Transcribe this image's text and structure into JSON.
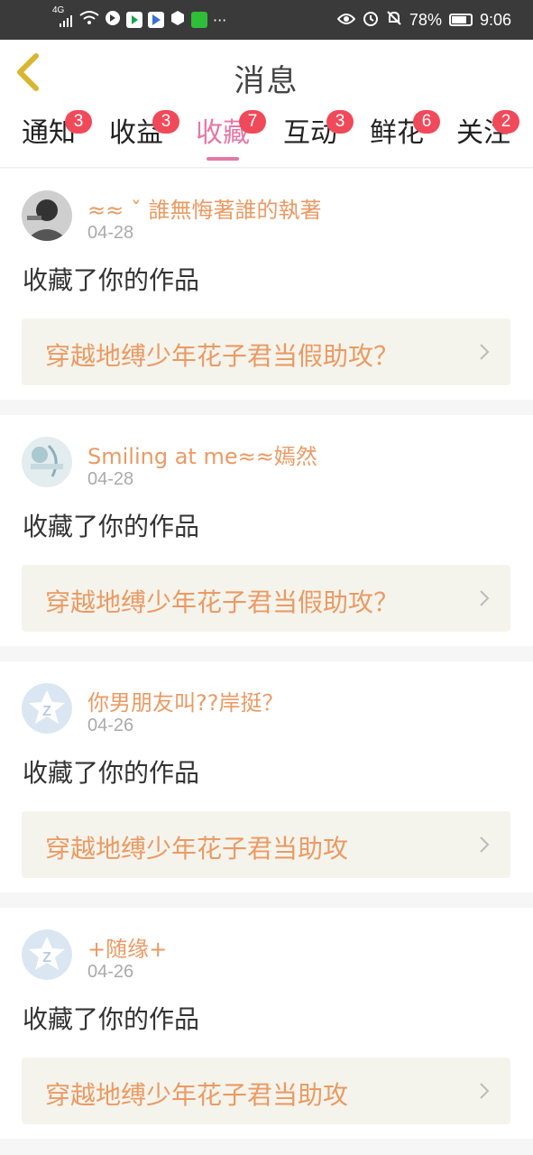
{
  "statusbar": {
    "network": "4G",
    "battery": "78%",
    "time": "9:06",
    "dots": "···"
  },
  "header": {
    "title": "消息"
  },
  "tabs": [
    {
      "label": "通知",
      "badge": "3",
      "active": false
    },
    {
      "label": "收益",
      "badge": "3",
      "active": false
    },
    {
      "label": "收藏",
      "badge": "7",
      "active": true
    },
    {
      "label": "互动",
      "badge": "3",
      "active": false
    },
    {
      "label": "鲜花",
      "badge": "6",
      "active": false
    },
    {
      "label": "关注",
      "badge": "2",
      "active": false
    }
  ],
  "items": [
    {
      "user": "≈≈ ˇ 誰無悔著誰的執著",
      "date": "04-28",
      "action": "收藏了你的作品",
      "work": "穿越地缚少年花子君当假助攻？"
    },
    {
      "user": "Smiling at me≈≈嫣然",
      "date": "04-28",
      "action": "收藏了你的作品",
      "work": "穿越地缚少年花子君当假助攻？"
    },
    {
      "user": "你男朋友叫??岸挺？",
      "date": "04-26",
      "action": "收藏了你的作品",
      "work": "穿越地缚少年花子君当助攻"
    },
    {
      "user": "+随缘+",
      "date": "04-26",
      "action": "收藏了你的作品",
      "work": "穿越地缚少年花子君当助攻"
    }
  ],
  "colors": {
    "accent": "#e577a6",
    "badge": "#f04a5a",
    "username": "#eb9a63",
    "work_bg": "#f5f4ec"
  },
  "icons": {
    "back": "chevron-left-icon",
    "default_avatar": "app-logo-avatar"
  }
}
